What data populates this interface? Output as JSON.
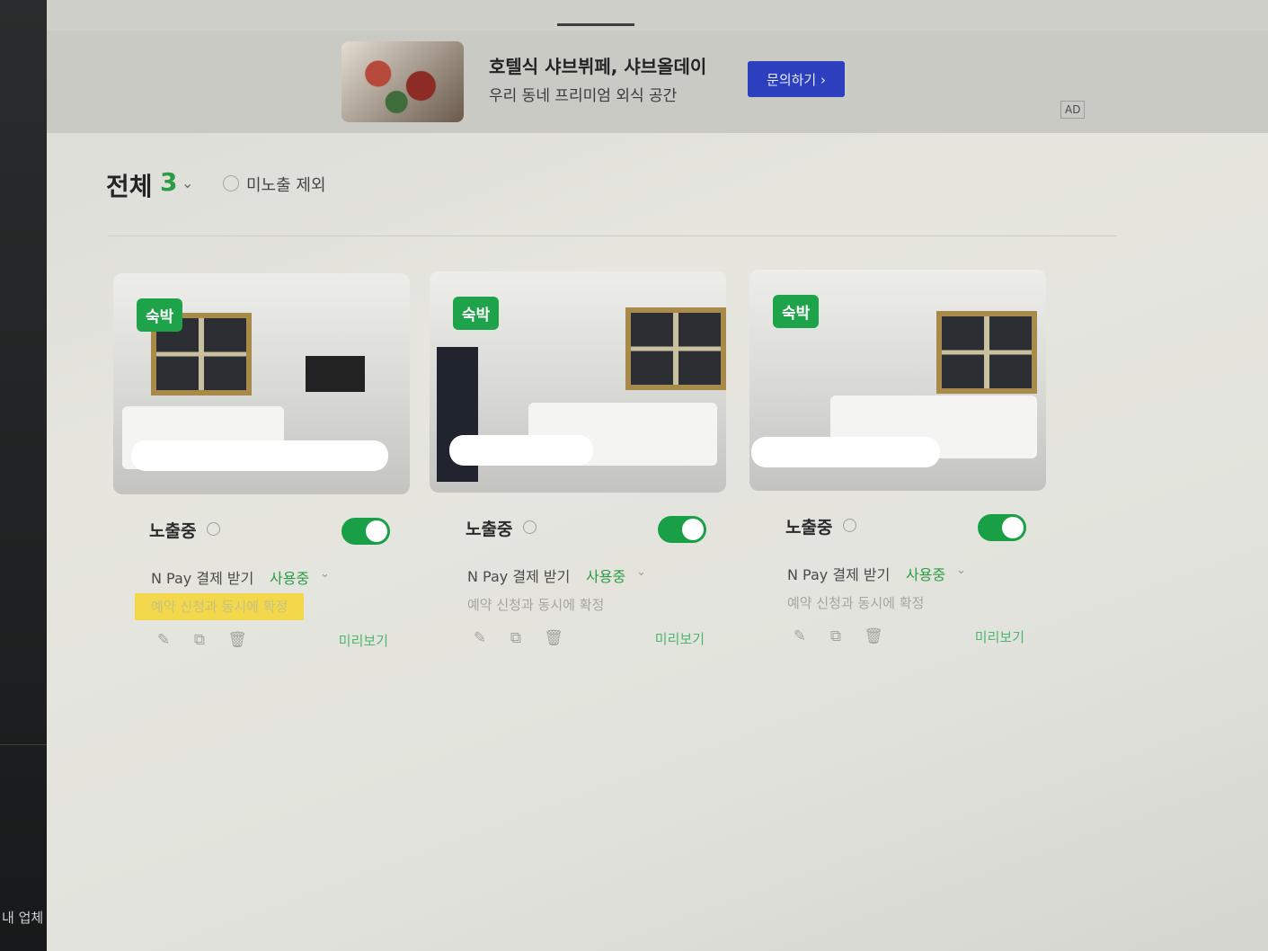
{
  "sidebar": {
    "footer_label": "내 업체"
  },
  "ad": {
    "title": "호텔식 샤브뷔페, 샤브올데이",
    "subtitle": "우리 동네 프리미엄 외식 공간",
    "cta": "문의하기 ›",
    "badge": "AD"
  },
  "filter": {
    "title": "전체",
    "count": "3",
    "chevron": "⌄",
    "exclude_label": "미노출 제외"
  },
  "cards": [
    {
      "badge": "숙박",
      "status": "노출중",
      "toggle_on": true,
      "pay_label": "N Pay 결제 받기",
      "pay_status": "사용중",
      "confirm": "예약 신청과 동시에 확정",
      "confirm_highlight": true,
      "preview": "미리보기"
    },
    {
      "badge": "숙박",
      "status": "노출중",
      "toggle_on": true,
      "pay_label": "N Pay 결제 받기",
      "pay_status": "사용중",
      "confirm": "예약 신청과 동시에 확정",
      "confirm_highlight": false,
      "preview": "미리보기"
    },
    {
      "badge": "숙박",
      "status": "노출중",
      "toggle_on": true,
      "pay_label": "N Pay 결제 받기",
      "pay_status": "사용중",
      "confirm": "예약 신청과 동시에 확정",
      "confirm_highlight": false,
      "preview": "미리보기"
    }
  ],
  "icons": {
    "edit": "✎",
    "copy": "⧉",
    "delete": "🗑",
    "info": "i",
    "chevron": "⌄"
  },
  "colors": {
    "accent_green": "#1fa34a",
    "ad_button": "#2b3fbf",
    "highlight": "#f2d84a"
  }
}
